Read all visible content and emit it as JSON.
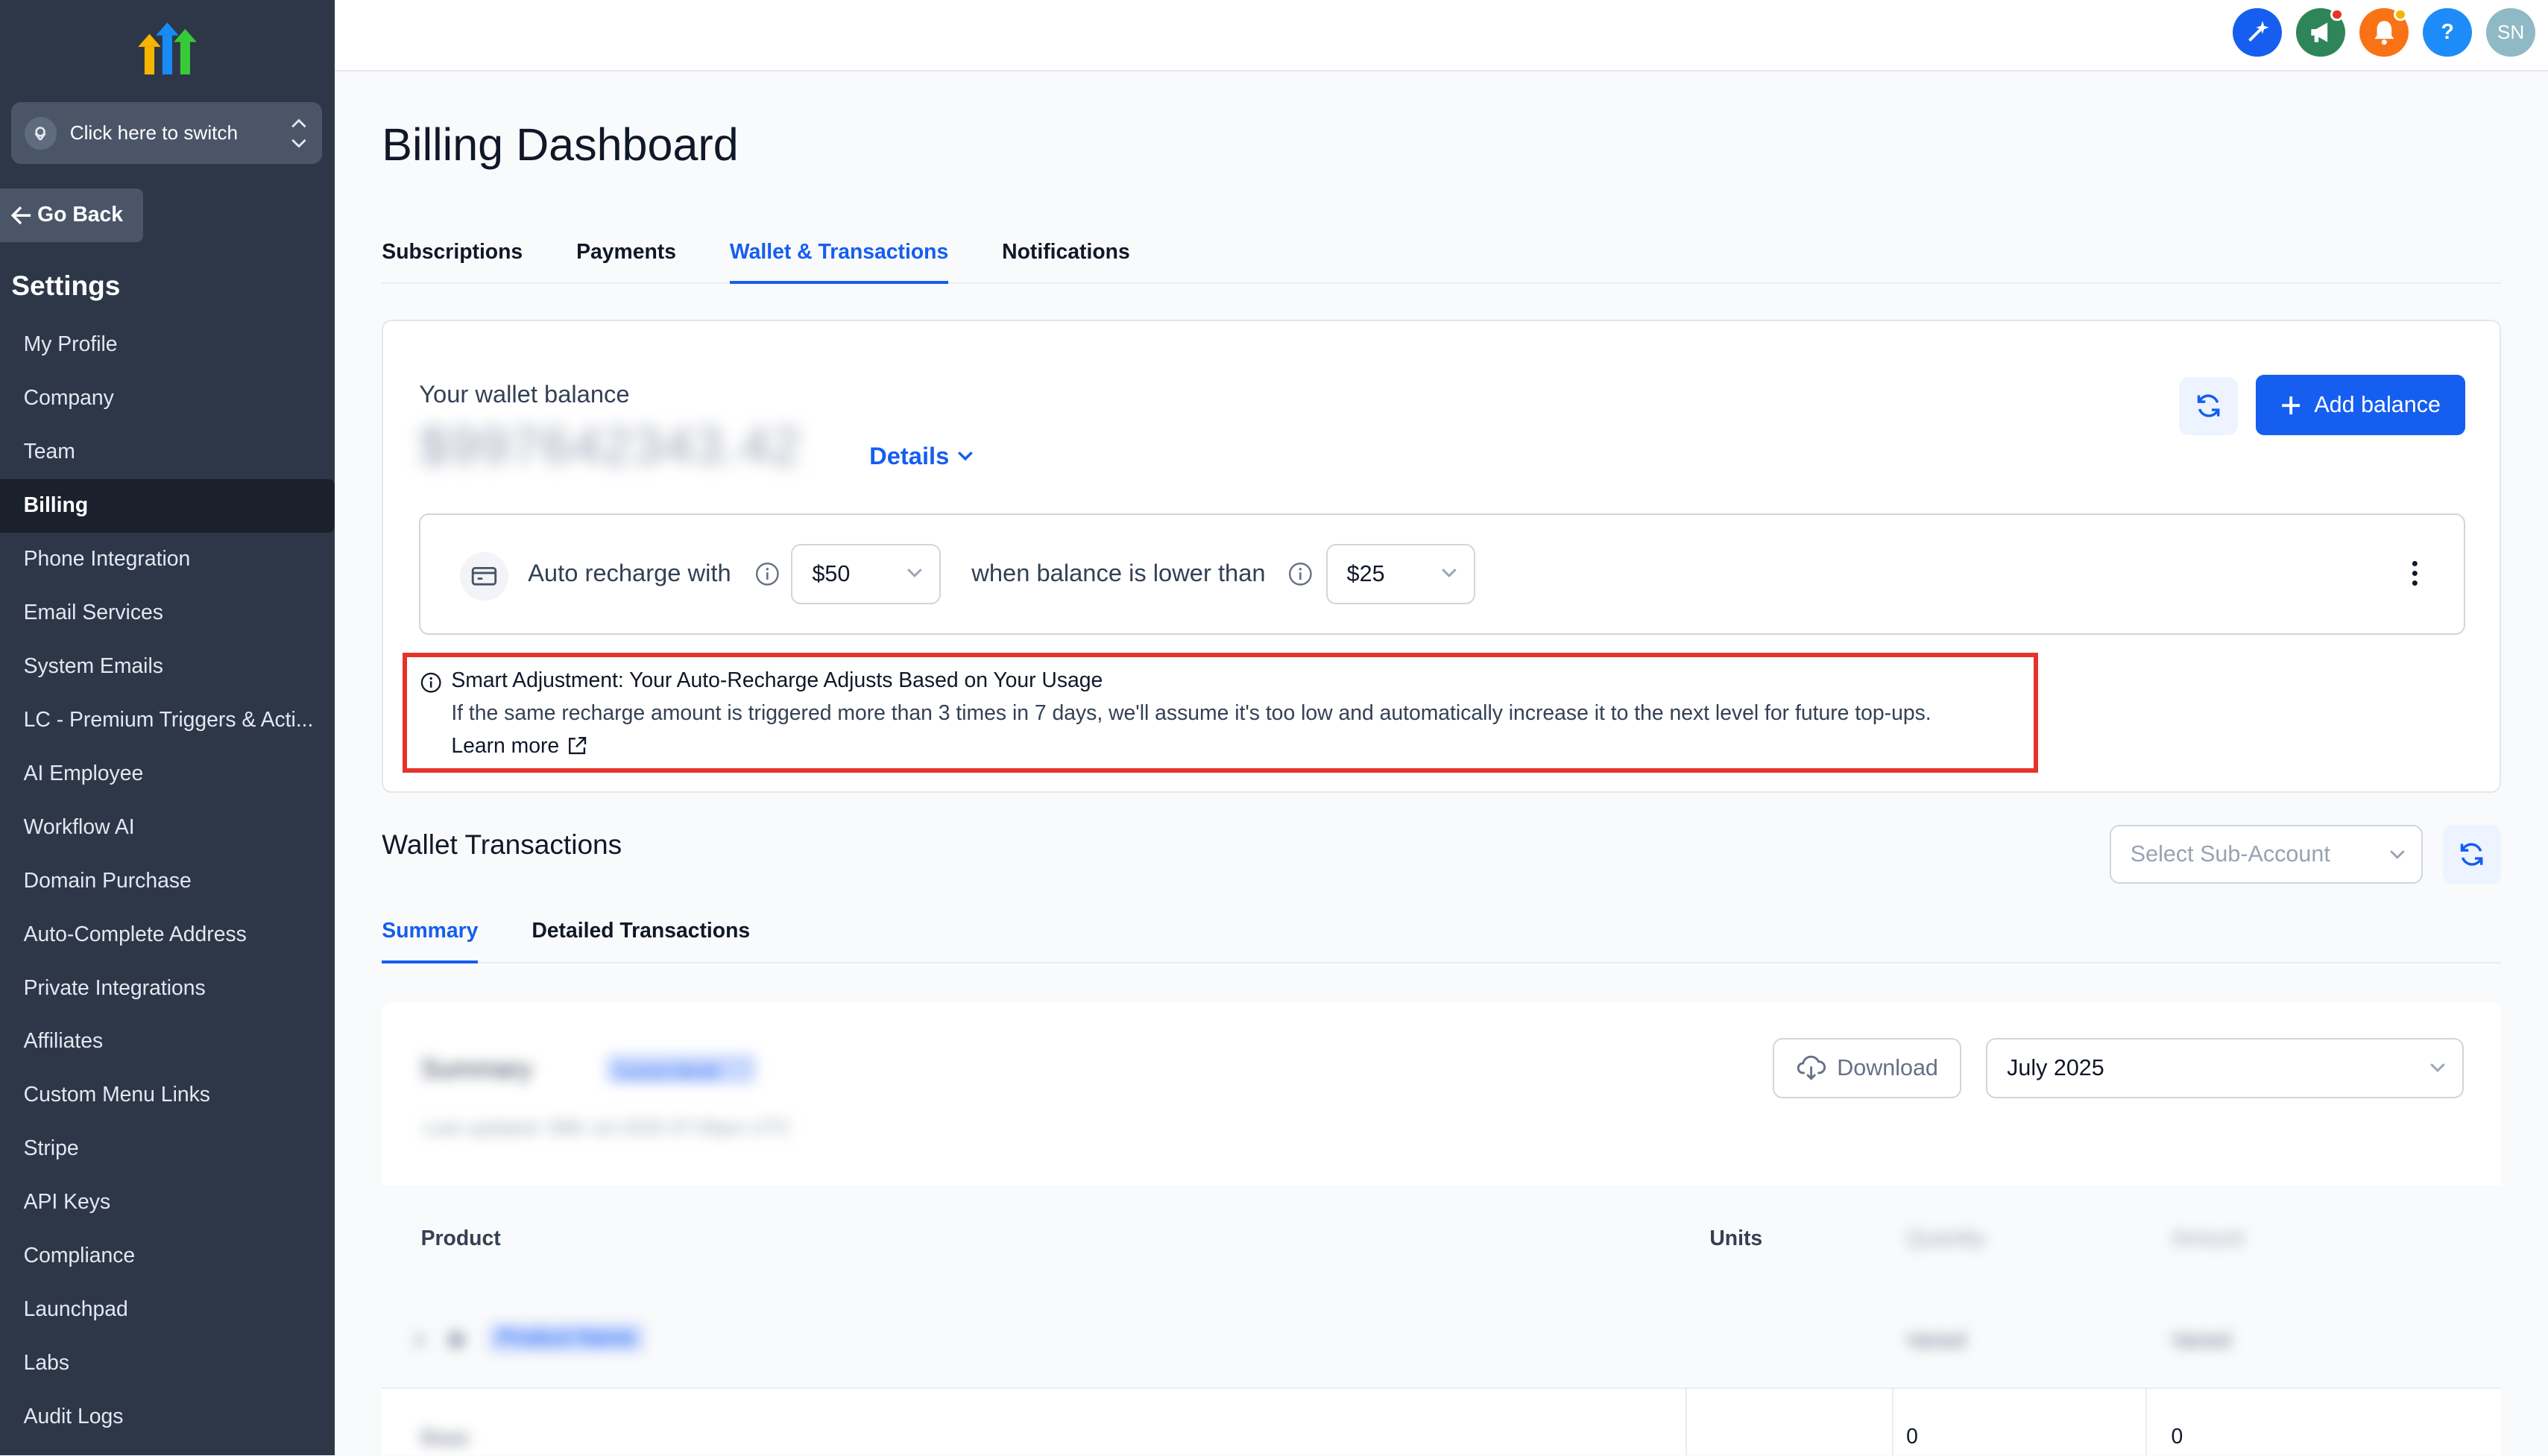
{
  "sidebar": {
    "switcher_label": "Click here to switch",
    "go_back": "Go Back",
    "settings_title": "Settings",
    "items": [
      {
        "label": "My Profile"
      },
      {
        "label": "Company"
      },
      {
        "label": "Team"
      },
      {
        "label": "Billing",
        "active": true
      },
      {
        "label": "Phone Integration"
      },
      {
        "label": "Email Services"
      },
      {
        "label": "System Emails"
      },
      {
        "label": "LC - Premium Triggers & Acti..."
      },
      {
        "label": "AI Employee"
      },
      {
        "label": "Workflow AI"
      },
      {
        "label": "Domain Purchase"
      },
      {
        "label": "Auto-Complete Address"
      },
      {
        "label": "Private Integrations"
      },
      {
        "label": "Affiliates"
      },
      {
        "label": "Custom Menu Links"
      },
      {
        "label": "Stripe"
      },
      {
        "label": "API Keys"
      },
      {
        "label": "Compliance"
      },
      {
        "label": "Launchpad"
      },
      {
        "label": "Labs"
      },
      {
        "label": "Audit Logs"
      }
    ]
  },
  "topbar": {
    "avatar_initials": "SN",
    "help_label": "?",
    "colors": {
      "ai": "#155eef",
      "announce": "#2f855a",
      "bell": "#f97316",
      "help": "#1d8cf8",
      "avatar": "#8fb9c4"
    }
  },
  "page": {
    "title": "Billing Dashboard",
    "tabs": [
      {
        "label": "Subscriptions"
      },
      {
        "label": "Payments"
      },
      {
        "label": "Wallet & Transactions",
        "active": true
      },
      {
        "label": "Notifications"
      }
    ]
  },
  "wallet": {
    "balance_label": "Your wallet balance",
    "balance_value": "$997642343.42",
    "details_label": "Details",
    "add_balance_label": "Add balance",
    "auto_recharge_label": "Auto recharge with",
    "recharge_amount": "$50",
    "threshold_label": "when balance is lower than",
    "threshold_amount": "$25",
    "smart": {
      "title": "Smart Adjustment: Your Auto-Recharge Adjusts Based on Your Usage",
      "body": "If the same recharge amount is triggered more than 3 times in 7 days, we'll assume it's too low and automatically increase it to the next level for future top-ups.",
      "link": "Learn more"
    }
  },
  "transactions": {
    "title": "Wallet Transactions",
    "subaccount_placeholder": "Select Sub-Account",
    "tabs": [
      {
        "label": "Summary",
        "active": true
      },
      {
        "label": "Detailed Transactions"
      }
    ],
    "summary": {
      "title": "Summary",
      "pill": "Current Month",
      "subtitle": "Last updated: 08th Jul 2025 07:00pm UTC",
      "download_label": "Download",
      "month": "July 2025"
    },
    "table": {
      "headers": [
        "Product",
        "Units",
        "Quantity",
        "Amount"
      ],
      "row1": {
        "name": "Product Name",
        "quantity": "Varied",
        "amount": "Varied"
      },
      "row2": {
        "name": "Base",
        "quantity": "0",
        "amount": "0"
      }
    }
  }
}
